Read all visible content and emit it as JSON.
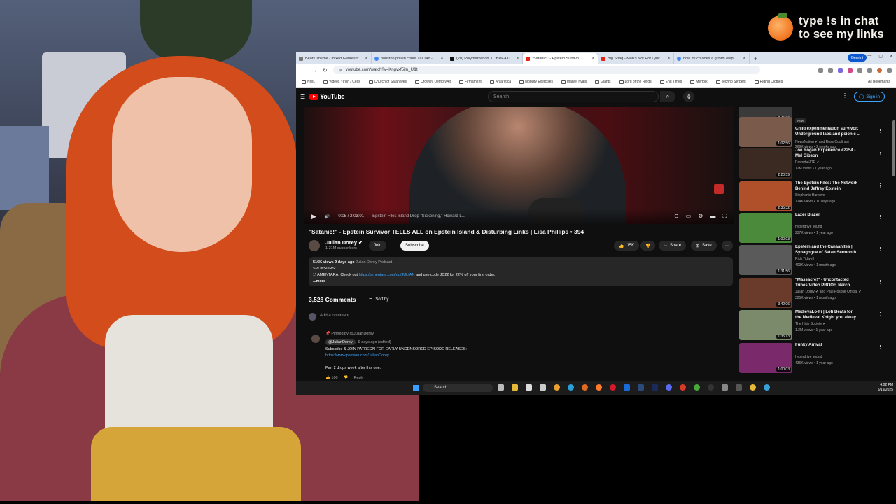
{
  "overlay": {
    "line1": "type !s in chat",
    "line2": "to see my links"
  },
  "browser": {
    "tabs": [
      {
        "label": "Beats Theme - mixed Genres fr",
        "icon": "page-icon",
        "active": false
      },
      {
        "label": "houston pollen count TODAY -",
        "icon": "google-icon",
        "active": false
      },
      {
        "label": "(20) Polymarket on X: \"BREAKI",
        "icon": "x-icon",
        "active": false
      },
      {
        "label": "\"Satanic!\" - Epstein Survivo",
        "icon": "youtube-icon",
        "active": true
      },
      {
        "label": "Big Shaq - Man's Not Hot Lyric",
        "icon": "youtube-icon",
        "active": false
      },
      {
        "label": "how much does a grown elepi",
        "icon": "google-icon",
        "active": false
      }
    ],
    "gemini_label": "Gemini",
    "url": "youtube.com/watch?v=Kngvxf5im_U&t",
    "bookmarks": [
      "NWL",
      "Videos ~Irish / Celts",
      "Church of Satan wes",
      "Crowley Demon/Alt",
      "Firmament",
      "Antarctica",
      "Mobility Exercises",
      "marvel rivals",
      "Giants",
      "Lord of the Rings",
      "End Times",
      "Merfolk",
      "Techno Serpent",
      "Riding Clothes"
    ],
    "all_bookmarks": "All Bookmarks"
  },
  "youtube": {
    "logo_text": "YouTube",
    "search_placeholder": "Search",
    "sign_in": "Sign in",
    "player": {
      "time": "0:05 / 2:03:01",
      "chapter": "Epstein Files Island Drop \"Sickening,\" Howard L..."
    },
    "video_title": "\"Satanic!\" - Epstein Survivor TELLS ALL on Epstein Island & Disturbing Links | Lisa Phillips • 394",
    "channel": {
      "name": "Julian Dorey",
      "subs": "1.21M subscribers",
      "join": "Join",
      "subscribe": "Subscribe"
    },
    "actions": {
      "likes": "15K",
      "share": "Share",
      "save": "Save"
    },
    "description": {
      "meta": "516K views  9 days ago",
      "podcast": "Julian Dorey Podcast",
      "sponsors": "SPONSORS:",
      "line_prefix": "1) AMENTARA: Check out ",
      "link": "https://amentara.com/go/JULIAN",
      "line_suffix": " and use code JD22 for 22% off your first order.",
      "more": "...more"
    },
    "comments": {
      "count": "3,528 Comments",
      "sort": "Sort by",
      "add": "Add a comment...",
      "pinned_by": "Pinned by @JulianDorey",
      "author": "@JulianDorey",
      "ago": "9 days ago (edited)",
      "line1": "Subscribe & JOIN PATREON FOR EARLY UNCENSORED EPISODE RELEASES:",
      "line2": "https://www.patreon.com/JulianDorey",
      "line3": "Part 2 drops week after this one.",
      "likes": "100",
      "reply": "Reply"
    },
    "sidebar": [
      {
        "title1": "",
        "title2": "",
        "channel": "",
        "views": "",
        "duration": "2:45:39",
        "thumb": "#3a3a3a",
        "partial": true
      },
      {
        "title1": "Child experimentation survivor:",
        "title2": "Underground labs and psionic ...",
        "channel": "NewsNation ✔ and Ross Coulthart",
        "views": "269K views • 2 weeks ago",
        "duration": "1:02:56",
        "thumb": "#7a5a4a",
        "new": "New"
      },
      {
        "title1": "Joe Rogan Experience #2254 -",
        "title2": "Mel Gibson",
        "channel": "PowerfulJRE ✔",
        "views": "12M views • 1 year ago",
        "duration": "2:20:59",
        "thumb": "#3a2a22"
      },
      {
        "title1": "The Epstein Files: The Network",
        "title2": "Behind Jeffrey Epstein",
        "channel": "Stephanie Harlowe",
        "views": "724K views • 10 days ago",
        "duration": "2:35:32",
        "thumb": "#b0502a"
      },
      {
        "title1": "Lazer Blazer",
        "title2": "",
        "channel": "hyperdrive sound",
        "views": "237K views • 1 year ago",
        "duration": "1:00:03",
        "thumb": "#4a8a3a"
      },
      {
        "title1": "Epstein and the Canaanites |",
        "title2": "Synagogue of Satan Sermon b...",
        "channel": "Rich Tidwell",
        "views": "409K views • 1 month ago",
        "duration": "1:31:56",
        "thumb": "#5a5a5a"
      },
      {
        "title1": "\"Massacre!\" - Uncontacted",
        "title2": "Tribes Video PROOF, Narco ...",
        "channel": "Julian Dorey ✔ and Paul Rosolie Official ✔",
        "views": "325K views • 1 month ago",
        "duration": "3:42:06",
        "thumb": "#6a3a2a"
      },
      {
        "title1": "MedievaLo-Fi | Lofi Beats for",
        "title2": "the Medieval Knight you alway...",
        "channel": "The High Society ✔",
        "views": "1.2M views • 1 year ago",
        "duration": "1:35:13",
        "thumb": "#7a8a6a"
      },
      {
        "title1": "Funky Arrival",
        "title2": "",
        "channel": "hyperdrive sound",
        "views": "436K views • 1 year ago",
        "duration": "1:00:03",
        "thumb": "#7a2a6a"
      }
    ]
  },
  "taskbar": {
    "search": "Search",
    "time": "4:02 PM",
    "date": "5/19/2025"
  }
}
